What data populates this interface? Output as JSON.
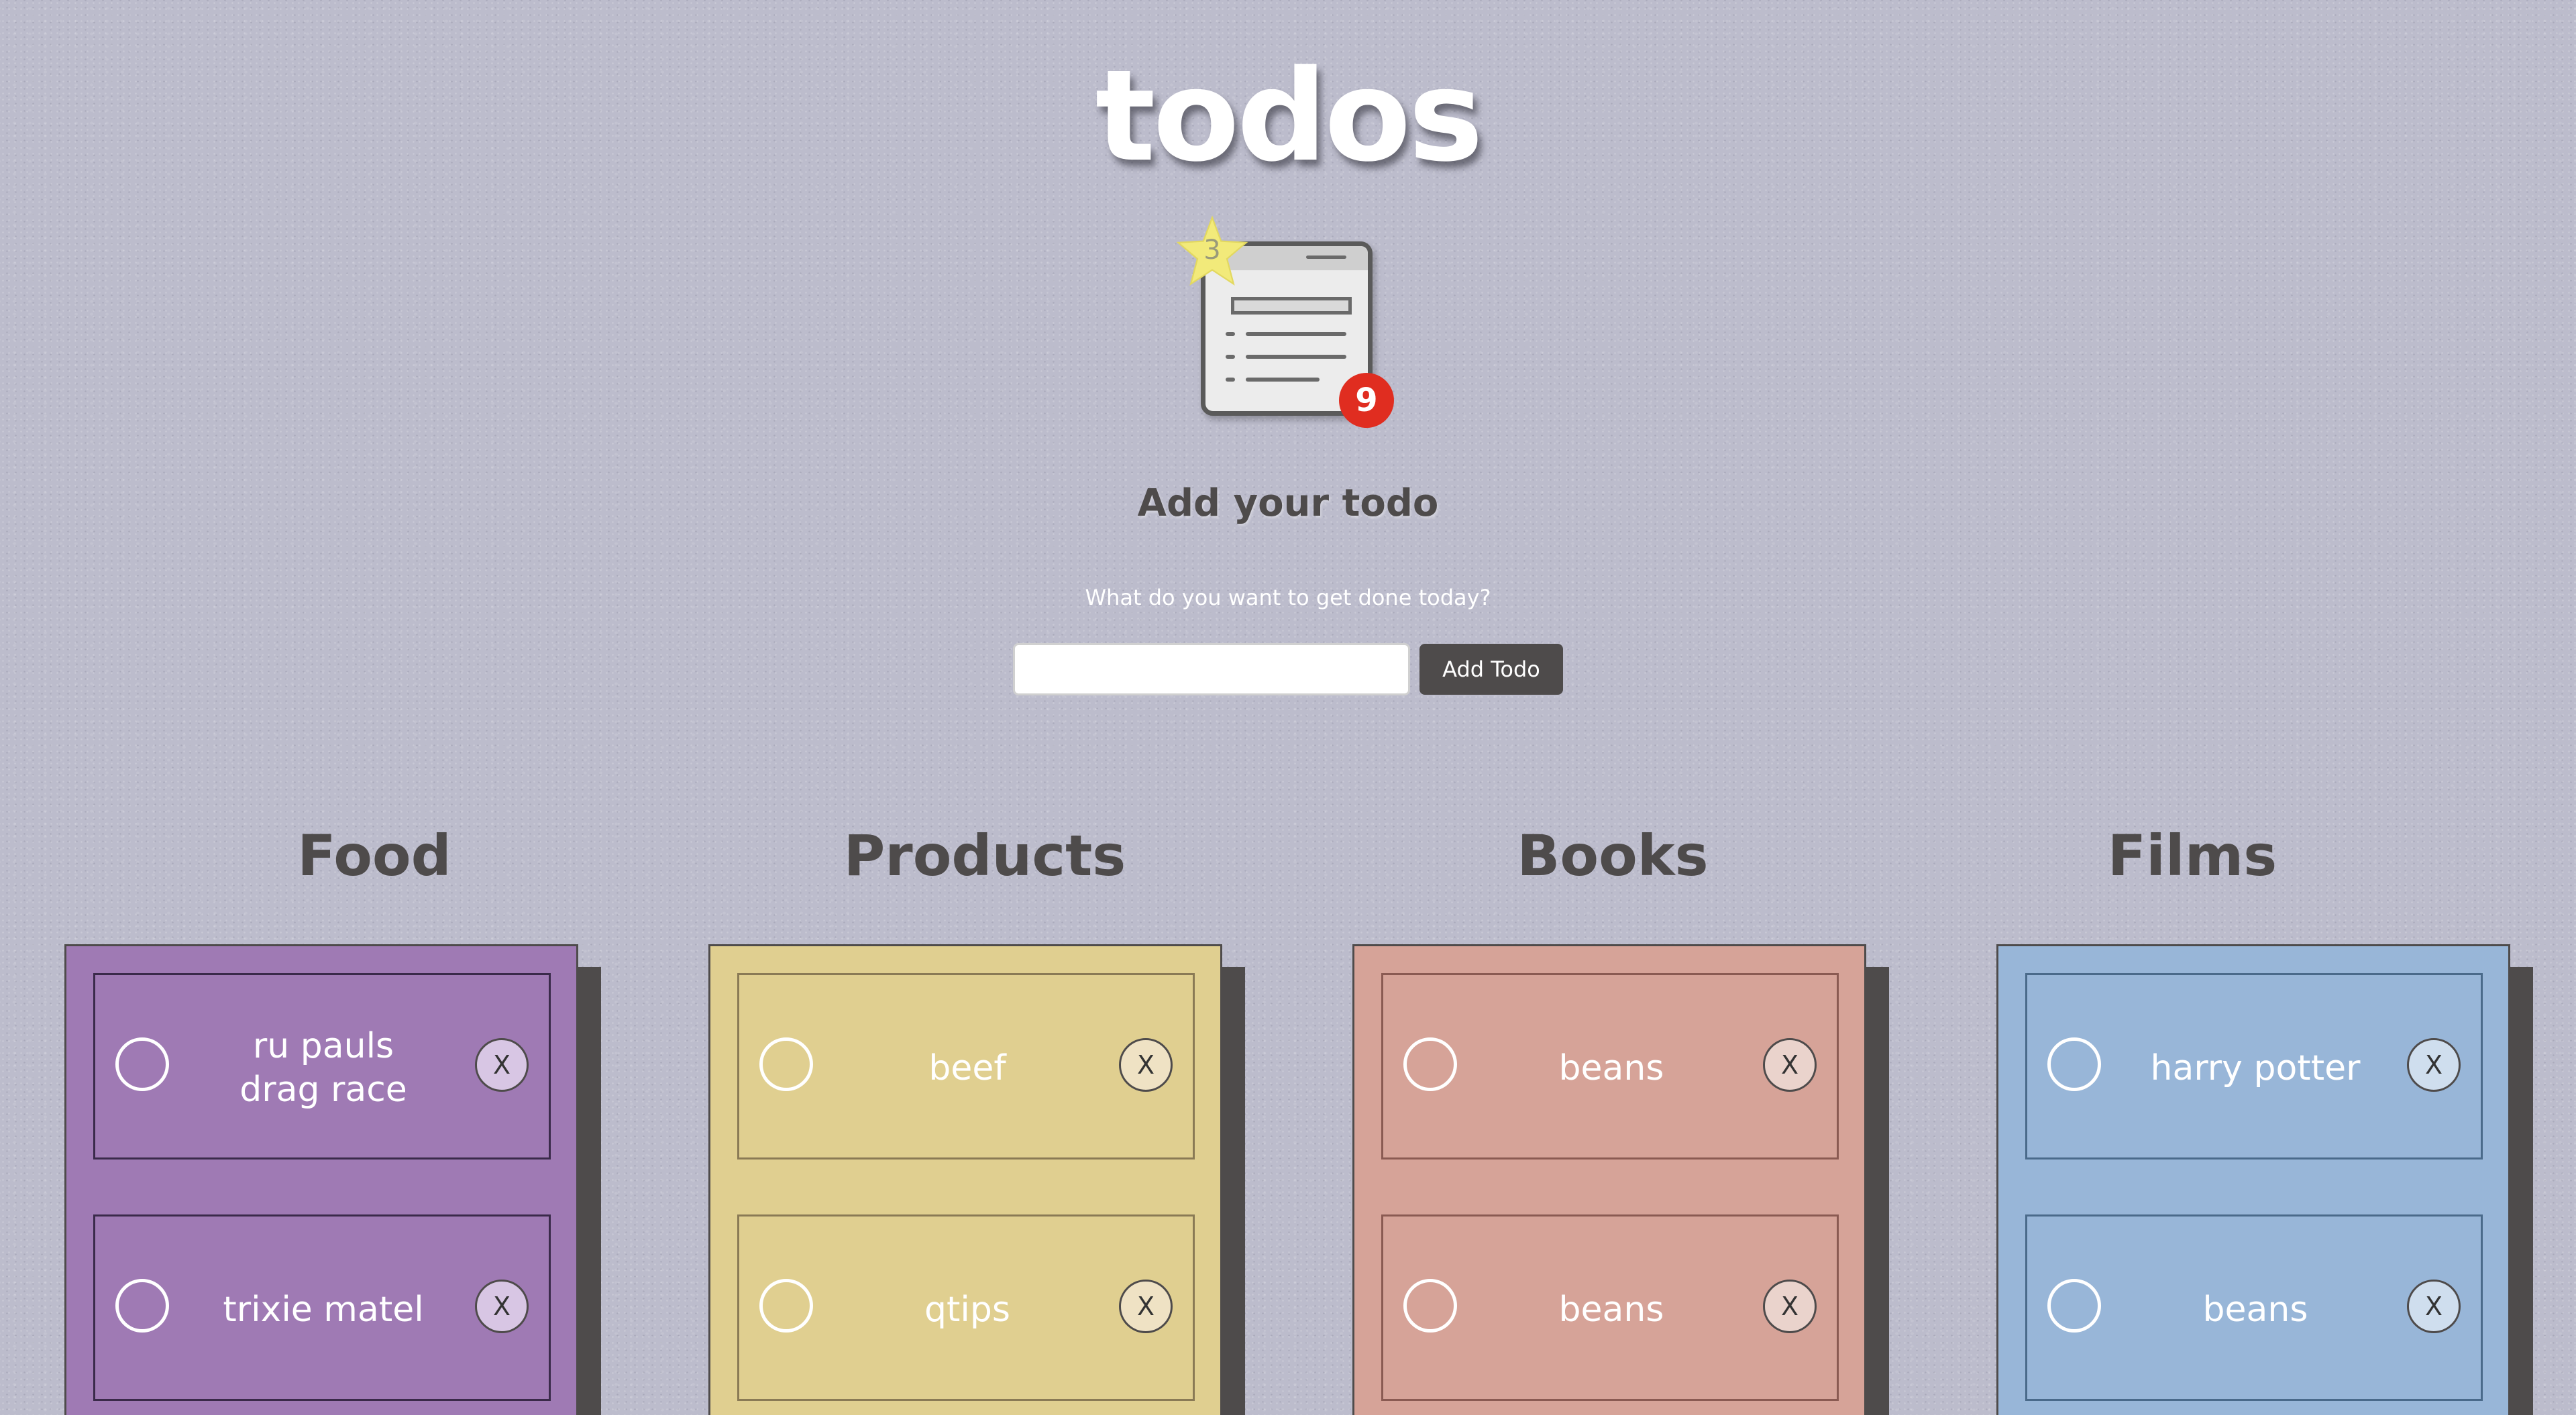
{
  "app": {
    "title": "todos"
  },
  "badges": {
    "star_count": "3",
    "todo_count": "9"
  },
  "add_section": {
    "heading": "Add your todo",
    "prompt": "What do you want to get done today?",
    "input_value": "",
    "input_placeholder": "",
    "button_label": "Add Todo"
  },
  "categories": [
    {
      "name": "Food",
      "color": "#9f7ab4",
      "card_border": "#3a2a4a",
      "delete_bg": "#d8c6e4",
      "items": [
        {
          "text": "ru pauls drag race",
          "delete_label": "X"
        },
        {
          "text": "trixie matel",
          "delete_label": "X"
        }
      ]
    },
    {
      "name": "Products",
      "color": "#e0cf90",
      "card_border": "#8a7a55",
      "delete_bg": "#efe2c4",
      "items": [
        {
          "text": "beef",
          "delete_label": "X"
        },
        {
          "text": "qtips",
          "delete_label": "X"
        }
      ]
    },
    {
      "name": "Books",
      "color": "#d6a398",
      "card_border": "#8a5a52",
      "delete_bg": "#ead3cc",
      "items": [
        {
          "text": "beans",
          "delete_label": "X"
        },
        {
          "text": "beans",
          "delete_label": "X"
        }
      ]
    },
    {
      "name": "Films",
      "color": "#98b6d8",
      "card_border": "#4a6a8a",
      "delete_bg": "#cfdeee",
      "items": [
        {
          "text": "harry potter",
          "delete_label": "X"
        },
        {
          "text": "beans",
          "delete_label": "X"
        }
      ]
    }
  ]
}
